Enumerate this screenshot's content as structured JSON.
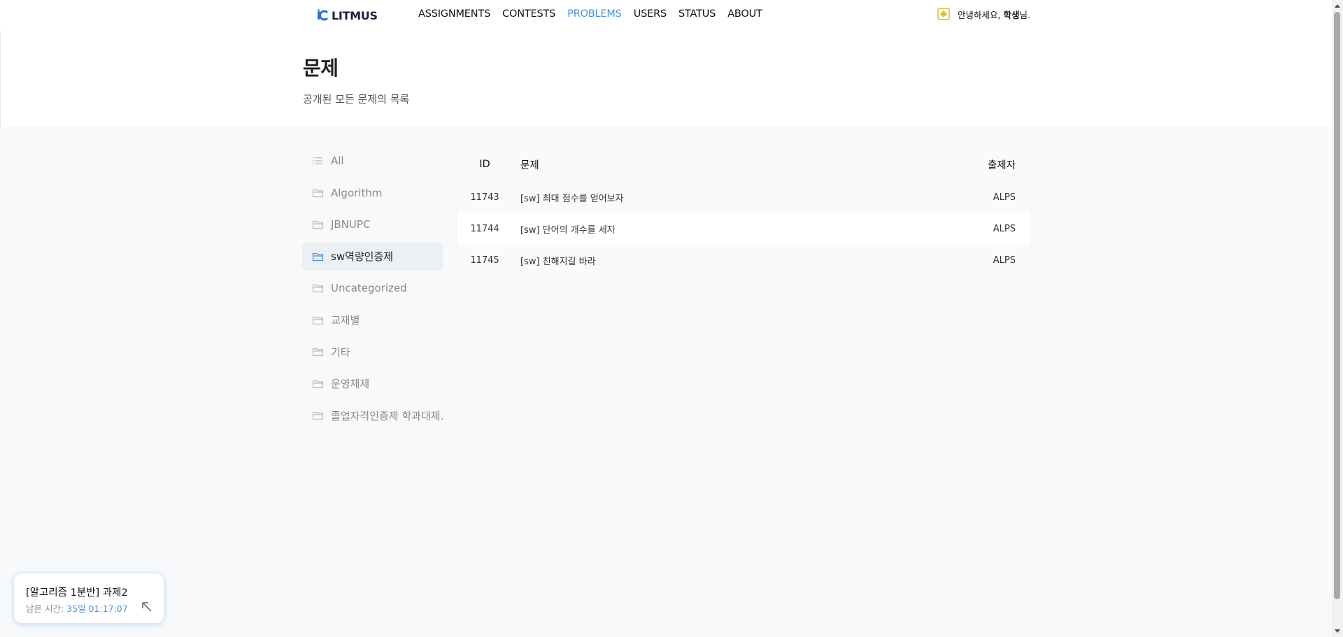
{
  "nav": {
    "brand": "LITMUS",
    "items": [
      {
        "label": "ASSIGNMENTS",
        "active": false
      },
      {
        "label": "CONTESTS",
        "active": false
      },
      {
        "label": "PROBLEMS",
        "active": true
      },
      {
        "label": "USERS",
        "active": false
      },
      {
        "label": "STATUS",
        "active": false
      },
      {
        "label": "ABOUT",
        "active": false
      }
    ],
    "greeting_prefix": "안녕하세요, ",
    "user_name": "학생",
    "greeting_suffix": "님."
  },
  "header": {
    "title": "문제",
    "subtitle": "공개된 모든 문제의 목록"
  },
  "sidebar": {
    "items": [
      {
        "label": "All",
        "icon": "list-icon",
        "active": false
      },
      {
        "label": "Algorithm",
        "icon": "folder-icon",
        "active": false
      },
      {
        "label": "JBNUPC",
        "icon": "folder-icon",
        "active": false
      },
      {
        "label": "sw역량인증제",
        "icon": "folder-icon",
        "active": true
      },
      {
        "label": "Uncategorized",
        "icon": "folder-icon",
        "active": false
      },
      {
        "label": "교재별",
        "icon": "folder-icon",
        "active": false
      },
      {
        "label": "기타",
        "icon": "folder-icon",
        "active": false
      },
      {
        "label": "운영체제",
        "icon": "folder-icon",
        "active": false
      },
      {
        "label": "졸업자격인증제 학과대체.",
        "icon": "folder-icon",
        "active": false
      }
    ]
  },
  "table": {
    "headers": {
      "id": "ID",
      "title": "문제",
      "author": "출제자"
    },
    "rows": [
      {
        "id": "11743",
        "title": "[sw] 최대 점수를 얻어보자",
        "author": "ALPS"
      },
      {
        "id": "11744",
        "title": "[sw] 단어의 개수를 세자",
        "author": "ALPS"
      },
      {
        "id": "11745",
        "title": "[sw] 친해지길 바라",
        "author": "ALPS"
      }
    ]
  },
  "timer": {
    "title": "[알고리즘 1분반] 과제2",
    "remaining_label": "남은 시간: ",
    "remaining_value": "35일 01:17:07"
  },
  "colors": {
    "accent": "#4a90e2",
    "active_bg": "#edf0f3",
    "page_bg": "#f8f9fb"
  }
}
